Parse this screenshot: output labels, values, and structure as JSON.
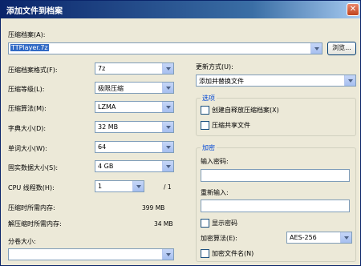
{
  "window": {
    "title": "添加文件到档案",
    "close": "✕"
  },
  "archive": {
    "label": "压缩档案(A):",
    "value": "TTPlayer.7z",
    "browse_label": "浏览..."
  },
  "left": {
    "format": {
      "label": "压缩档案格式(F):",
      "value": "7z"
    },
    "level": {
      "label": "压缩等级(L):",
      "value": "极限压缩"
    },
    "method": {
      "label": "压缩算法(M):",
      "value": "LZMA"
    },
    "dict": {
      "label": "字典大小(D):",
      "value": "32 MB"
    },
    "word": {
      "label": "单词大小(W):",
      "value": "64"
    },
    "solid": {
      "label": "固实数据大小(S):",
      "value": "4 GB"
    },
    "threads": {
      "label": "CPU 线程数(H):",
      "value": "1",
      "max": "/ 1"
    },
    "mem_compress": {
      "label": "压缩时所需内存:",
      "value": "399 MB"
    },
    "mem_decompress": {
      "label": "解压缩时所需内存:",
      "value": "34 MB"
    },
    "split": {
      "label": "分卷大小:",
      "value": ""
    }
  },
  "right": {
    "update": {
      "label": "更新方式(U):",
      "value": "添加并替换文件"
    },
    "options": {
      "title": "选项",
      "sfx": "创建自释放压缩档案(X)",
      "shared": "压缩共享文件"
    },
    "encryption": {
      "title": "加密",
      "password_label": "输入密码:",
      "reenter_label": "重新输入:",
      "show_password": "显示密码",
      "algorithm_label": "加密算法(E):",
      "algorithm_value": "AES-256",
      "encrypt_names": "加密文件名(N)"
    }
  }
}
